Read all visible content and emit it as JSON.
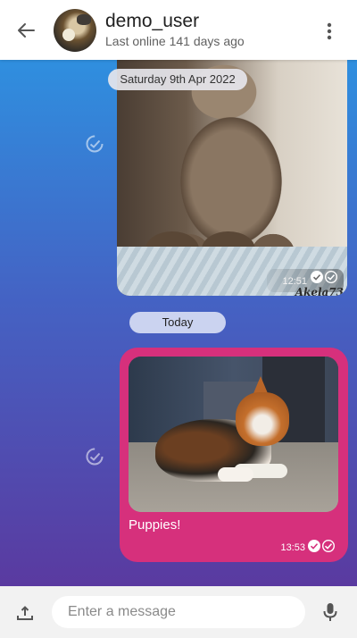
{
  "header": {
    "title": "demo_user",
    "subtitle": "Last online 141 days ago",
    "back_icon": "arrow-left-icon",
    "more_icon": "more-vert-icon"
  },
  "messages": [
    {
      "type": "image",
      "date_divider": "Saturday 9th Apr 2022",
      "time": "12:51",
      "watermark": "Akela73",
      "status": "read"
    },
    {
      "type": "image",
      "date_divider": "Today",
      "caption": "Puppies!",
      "time": "13:53",
      "status": "read",
      "bubble_color": "#d6307c"
    }
  ],
  "composer": {
    "placeholder": "Enter a message",
    "attach_icon": "upload-icon",
    "mic_icon": "mic-icon"
  },
  "colors": {
    "chat_gradient_top": "#2f8fdf",
    "chat_gradient_bottom": "#5a3aa0",
    "outgoing_bubble": "#d6307c"
  }
}
